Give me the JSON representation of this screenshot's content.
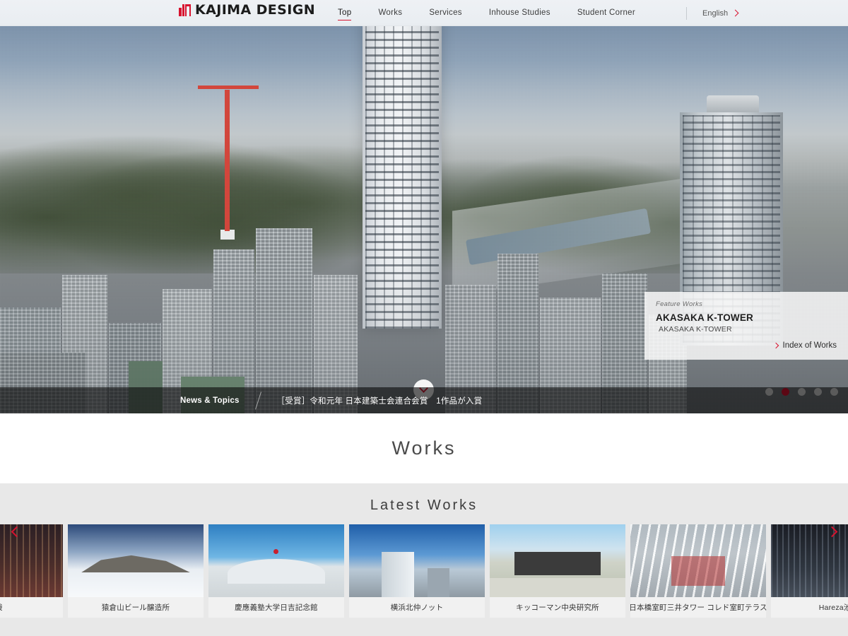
{
  "header": {
    "logo_text": "KAJIMA DESIGN",
    "logo_icon": "kajima-logo-mark",
    "nav": [
      {
        "label": "Top",
        "active": true
      },
      {
        "label": "Works",
        "active": false
      },
      {
        "label": "Services",
        "active": false
      },
      {
        "label": "Inhouse Studies",
        "active": false
      },
      {
        "label": "Student Corner",
        "active": false
      }
    ],
    "language": {
      "label": "English",
      "icon": "chevron-right-icon"
    }
  },
  "hero": {
    "feature_panel": {
      "kicker": "Feature Works",
      "title": "AKASAKA K-TOWER",
      "subtitle": "AKASAKA K-TOWER",
      "link_label": "Index of Works",
      "link_icon": "chevron-right-icon"
    },
    "scroll_button": {
      "icon": "chevron-down-icon"
    },
    "pagination": {
      "count": 5,
      "active_index": 1,
      "active_color": "#e00024"
    },
    "news": {
      "label": "News & Topics",
      "text": "［受賞］令和元年 日本建築士会連合会賞　1作品が入賞"
    }
  },
  "works_section": {
    "title": "Works"
  },
  "latest_works": {
    "title": "Latest Works",
    "prev_icon": "chevron-left-icon",
    "next_icon": "chevron-right-icon",
    "arrow_color": "#d8132f",
    "cards": [
      {
        "caption": "池袋",
        "art": "art-night",
        "partial": true
      },
      {
        "caption": "猿倉山ビール醸造所",
        "art": "art-snow",
        "partial": false
      },
      {
        "caption": "慶應義塾大学日吉記念館",
        "art": "art-hall",
        "partial": false
      },
      {
        "caption": "横浜北仲ノット",
        "art": "art-city",
        "partial": false
      },
      {
        "caption": "キッコーマン中央研究所",
        "art": "art-green",
        "partial": false
      },
      {
        "caption": "日本橋室町三井タワー コレド室町テラス",
        "art": "art-atrium",
        "partial": false
      },
      {
        "caption": "Hareza池袋",
        "art": "art-hareza",
        "partial": true
      }
    ]
  }
}
